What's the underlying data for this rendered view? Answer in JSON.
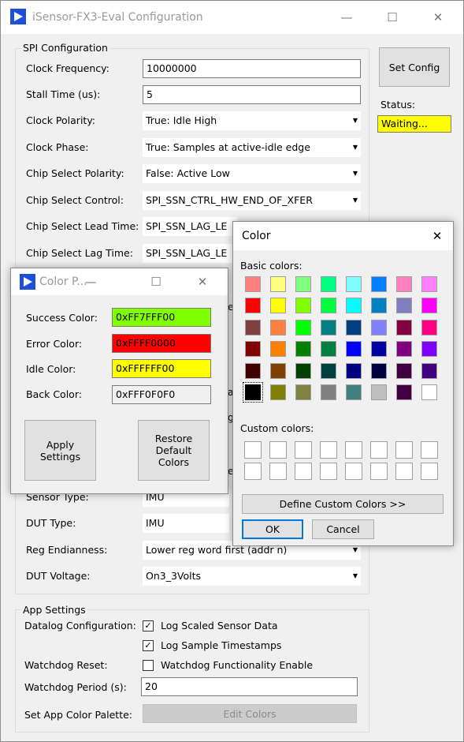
{
  "main": {
    "title": "iSensor-FX3-Eval Configuration",
    "spi_group": "SPI Configuration",
    "rows": [
      {
        "label": "Clock Frequency:",
        "value": "10000000"
      },
      {
        "label": "Stall Time (us):",
        "value": "5"
      },
      {
        "label": "Clock Polarity:",
        "value": "True: Idle High"
      },
      {
        "label": "Clock Phase:",
        "value": "True: Samples at active-idle edge"
      },
      {
        "label": "Chip Select Polarity:",
        "value": "False: Active Low"
      },
      {
        "label": "Chip Select Control:",
        "value": "SPI_SSN_CTRL_HW_END_OF_XFER"
      },
      {
        "label": "Chip Select Lead Time:",
        "value": "SPI_SSN_LAG_LE"
      },
      {
        "label": "Chip Select Lag Time:",
        "value": "SPI_SSN_LAG_LE"
      }
    ],
    "partial_fragments": [
      "es",
      "a",
      "g",
      "eg"
    ],
    "lower_rows": [
      {
        "label": "Sensor Type:",
        "value": "IMU"
      },
      {
        "label": "DUT Type:",
        "value": "IMU"
      },
      {
        "label": "Reg Endianness:",
        "value": "Lower reg word first (addr n)"
      },
      {
        "label": "DUT Voltage:",
        "value": "On3_3Volts"
      }
    ],
    "set_config": "Set Config",
    "status_label": "Status:",
    "status_value": "Waiting...",
    "app_group": "App Settings",
    "datalog_label": "Datalog Configuration:",
    "log_scaled": "Log Scaled Sensor Data",
    "log_timestamps": "Log Sample Timestamps",
    "watchdog_reset_label": "Watchdog Reset:",
    "watchdog_enable": "Watchdog Functionality Enable",
    "watchdog_period_label": "Watchdog Period (s):",
    "watchdog_period_value": "20",
    "palette_label": "Set App Color Palette:",
    "edit_colors": "Edit Colors"
  },
  "color_palette": {
    "title": "Color P...",
    "success_label": "Success Color:",
    "success_value": "0xFF7FFF00",
    "error_label": "Error Color:",
    "error_value": "0xFFFF0000",
    "idle_label": "Idle Color:",
    "idle_value": "0xFFFFFF00",
    "back_label": "Back Color:",
    "back_value": "0xFFF0F0F0",
    "apply": "Apply Settings",
    "restore": "Restore Default Colors"
  },
  "color_dialog": {
    "title": "Color",
    "basic_label": "Basic colors:",
    "custom_label": "Custom colors:",
    "define": "Define Custom Colors >>",
    "ok": "OK",
    "cancel": "Cancel",
    "basic_colors": [
      [
        "#ff8080",
        "#ffff80",
        "#80ff80",
        "#00ff80",
        "#80ffff",
        "#0080ff",
        "#ff80c0",
        "#ff80ff"
      ],
      [
        "#ff0000",
        "#ffff00",
        "#80ff00",
        "#00ff40",
        "#00ffff",
        "#0080c0",
        "#8080c0",
        "#ff00ff"
      ],
      [
        "#804040",
        "#ff8040",
        "#00ff00",
        "#008080",
        "#004080",
        "#8080ff",
        "#800040",
        "#ff0080"
      ],
      [
        "#800000",
        "#ff8000",
        "#008000",
        "#008040",
        "#0000ff",
        "#0000a0",
        "#800080",
        "#8000ff"
      ],
      [
        "#400000",
        "#804000",
        "#004000",
        "#004040",
        "#000080",
        "#000040",
        "#400040",
        "#400080"
      ],
      [
        "#000000",
        "#808000",
        "#808040",
        "#808080",
        "#408080",
        "#c0c0c0",
        "#400040",
        "#ffffff"
      ]
    ]
  },
  "colors": {
    "success": "#7fff00",
    "error": "#ff0000",
    "idle": "#ffff00",
    "back": "#f0f0f0",
    "status": "#ffff00"
  }
}
